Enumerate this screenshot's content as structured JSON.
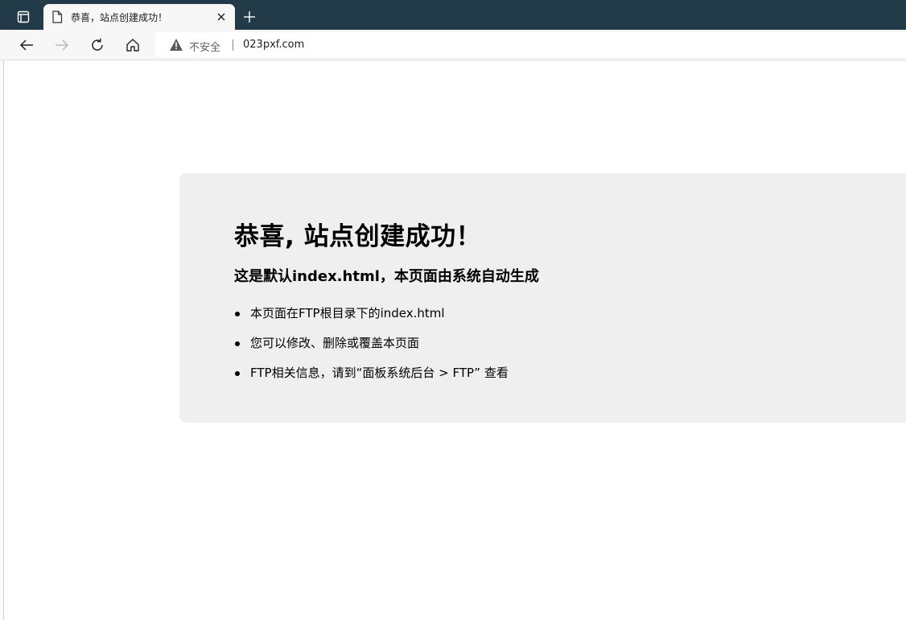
{
  "browser": {
    "tab": {
      "title": "恭喜，站点创建成功！",
      "icon": "page-icon",
      "close_icon": "close-icon"
    },
    "new_tab_icon": "plus-icon",
    "tab_actions_icon": "tab-actions-icon",
    "nav": {
      "back_icon": "back-arrow-icon",
      "forward_icon": "forward-arrow-icon",
      "refresh_icon": "refresh-icon",
      "home_icon": "home-icon"
    },
    "address_bar": {
      "security_icon": "warning-icon",
      "security_label": "不安全",
      "url": "023pxf.com"
    }
  },
  "page": {
    "heading": "恭喜, 站点创建成功！",
    "subheading": "这是默认index.html，本页面由系统自动生成",
    "items": [
      "本页面在FTP根目录下的index.html",
      "您可以修改、删除或覆盖本页面",
      "FTP相关信息，请到“面板系统后台 > FTP” 查看"
    ]
  },
  "colors": {
    "titlebar": "#233a48",
    "toolbar": "#f7f7f7",
    "card": "#efefef"
  }
}
